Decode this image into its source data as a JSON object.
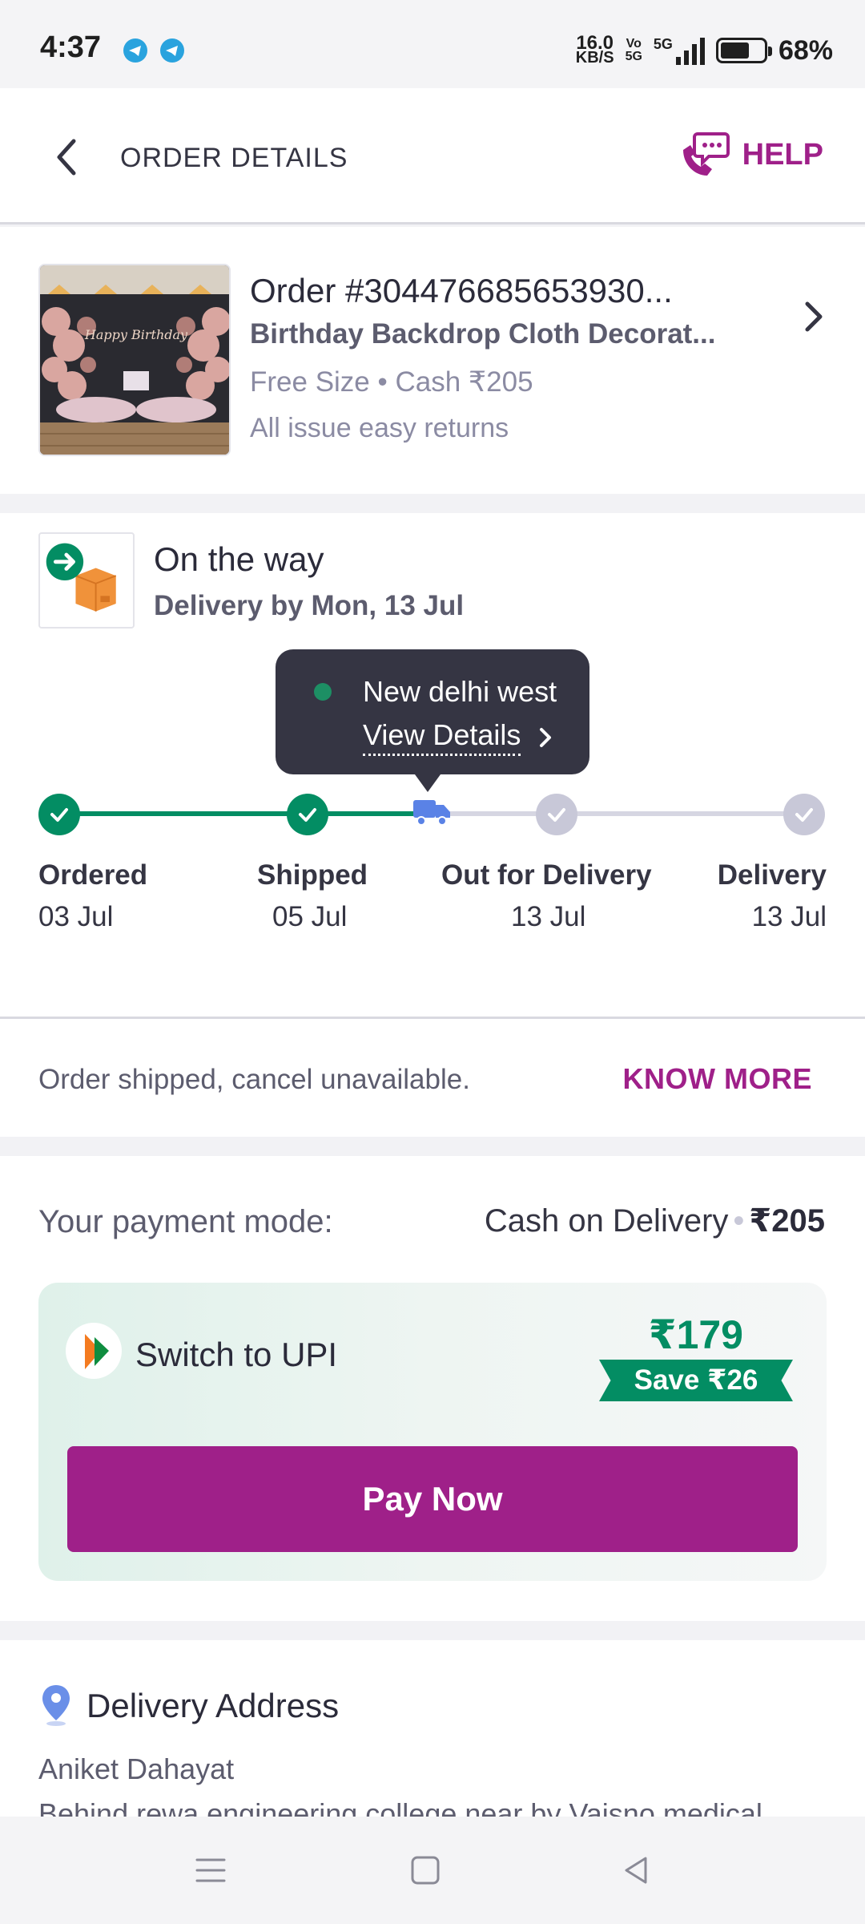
{
  "status_bar": {
    "time": "4:37",
    "net_speed_value": "16.0",
    "net_speed_unit": "KB/S",
    "volte_top": "Vo",
    "volte_bottom": "5G",
    "network": "5G",
    "battery": "68%"
  },
  "header": {
    "title": "ORDER DETAILS",
    "help_label": "HELP"
  },
  "order": {
    "id": "Order #304476685653930...",
    "product_name": "Birthday Backdrop Cloth Decorat...",
    "meta": "Free Size • Cash ₹205",
    "returns": "All issue easy returns",
    "thumb_text": "Happy Birthday"
  },
  "tracking": {
    "status": "On the way",
    "delivery_label": "Delivery by",
    "delivery_date": "Mon, 13 Jul",
    "tooltip_location": "New delhi west",
    "tooltip_link": "View Details",
    "steps": [
      {
        "label": "Ordered",
        "date": "03 Jul",
        "state": "done"
      },
      {
        "label": "Shipped",
        "date": "05 Jul",
        "state": "done"
      },
      {
        "label": "Out for Delivery",
        "date": "13 Jul",
        "state": "current"
      },
      {
        "label": "Delivery",
        "date": "13 Jul",
        "state": "pending"
      }
    ]
  },
  "cancel": {
    "text": "Order shipped, cancel unavailable.",
    "link": "KNOW MORE"
  },
  "payment": {
    "label": "Your payment mode:",
    "mode": "Cash on Delivery",
    "amount": "₹205",
    "upi_title": "Switch to UPI",
    "upi_price": "₹179",
    "upi_save": "Save ₹26",
    "pay_button": "Pay Now"
  },
  "address": {
    "title": "Delivery Address",
    "name": "Aniket Dahayat",
    "line1": "Behind rewa engineering college near by Vaisno medical"
  },
  "colors": {
    "brand": "#9f2089",
    "success": "#038d63",
    "text_dark": "#353543",
    "text_muted": "#8b8ba3"
  }
}
